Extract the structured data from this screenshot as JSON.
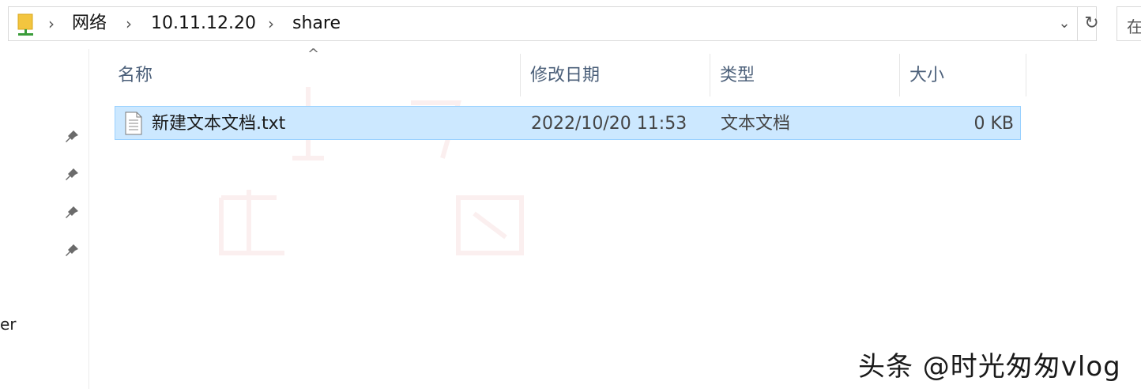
{
  "address": {
    "crumbs": [
      "网络",
      "10.11.12.20",
      "share"
    ],
    "separator": "›",
    "dropdown_icon": "chevron-down-icon",
    "refresh_icon": "refresh-icon"
  },
  "search": {
    "placeholder": "在"
  },
  "nav": {
    "partial_label": "er",
    "pin_count": 4
  },
  "columns": {
    "name": "名称",
    "modified": "修改日期",
    "type": "类型",
    "size": "大小",
    "sort_indicator": "^"
  },
  "files": [
    {
      "name": "新建文本文档.txt",
      "modified": "2022/10/20 11:53",
      "type": "文本文档",
      "size": "0 KB",
      "selected": true,
      "icon": "text-file-icon"
    }
  ],
  "watermark": "头条 @时光匆匆vlog",
  "colors": {
    "selection_bg": "#cce8ff",
    "selection_border": "#99d1ff",
    "header_text": "#4c607a"
  }
}
